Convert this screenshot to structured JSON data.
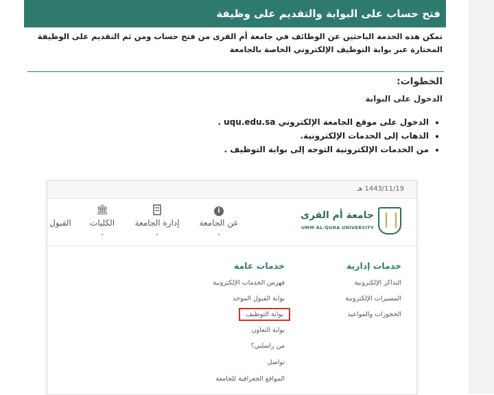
{
  "header": {
    "title": "فتح حساب على البوابة والتقديم على وظيفة"
  },
  "intro": {
    "text": "تمكن هذه الخدمة الباحثين عن الوظائف في جامعة أم القرى من فتح حساب ومن ثم التقديم على الوظيفة المختارة عبر بوابة التوظيف الإلكتروني الخاصة بالجامعة"
  },
  "steps": {
    "heading": "الخطوات:",
    "subheading": "الدخول على البوابة",
    "items": [
      {
        "text_before": "الدخول على موقع الجامعة الإلكتروني",
        "url": "uqu.edu.sa",
        "text_after": " ."
      },
      {
        "text": "الذهاب إلى الخدمات الإلكترونية."
      },
      {
        "text": "من الخدمات الإلكترونية التوجه إلى  بوابة التوظيف ."
      }
    ]
  },
  "screenshot": {
    "date": "1443/11/19 هـ",
    "logo": {
      "arabic": "جامعة أم القرى",
      "english": "UMM AL-QURA UNIVERSITY"
    },
    "nav": [
      {
        "label": "عن الجامعة",
        "icon": "info-icon"
      },
      {
        "label": "إدارة الجامعة",
        "icon": "building-icon"
      },
      {
        "label": "الكليات",
        "icon": "institution-icon"
      },
      {
        "label": "القبول",
        "icon": "none"
      }
    ],
    "admin_services": {
      "heading": "خدمات إدارية",
      "items": [
        "التذاكر الإلكترونية",
        "المسيرات الإلكترونية",
        "الحجوزات والمواعيد"
      ]
    },
    "general_services": {
      "heading": "خدمات عامة",
      "items": [
        "فهرس الخدمات الإلكترونية",
        "بوابة القبول الموحد",
        "بوابة التوظيف",
        "بوابة التعاون",
        "من راسلني؟",
        "تواصل",
        "المواقع الجغرافية للجامعة"
      ],
      "highlighted": "بوابة التوظيف"
    },
    "colors": {
      "accent": "#2f7a6e",
      "highlight": "#d0312d"
    }
  }
}
